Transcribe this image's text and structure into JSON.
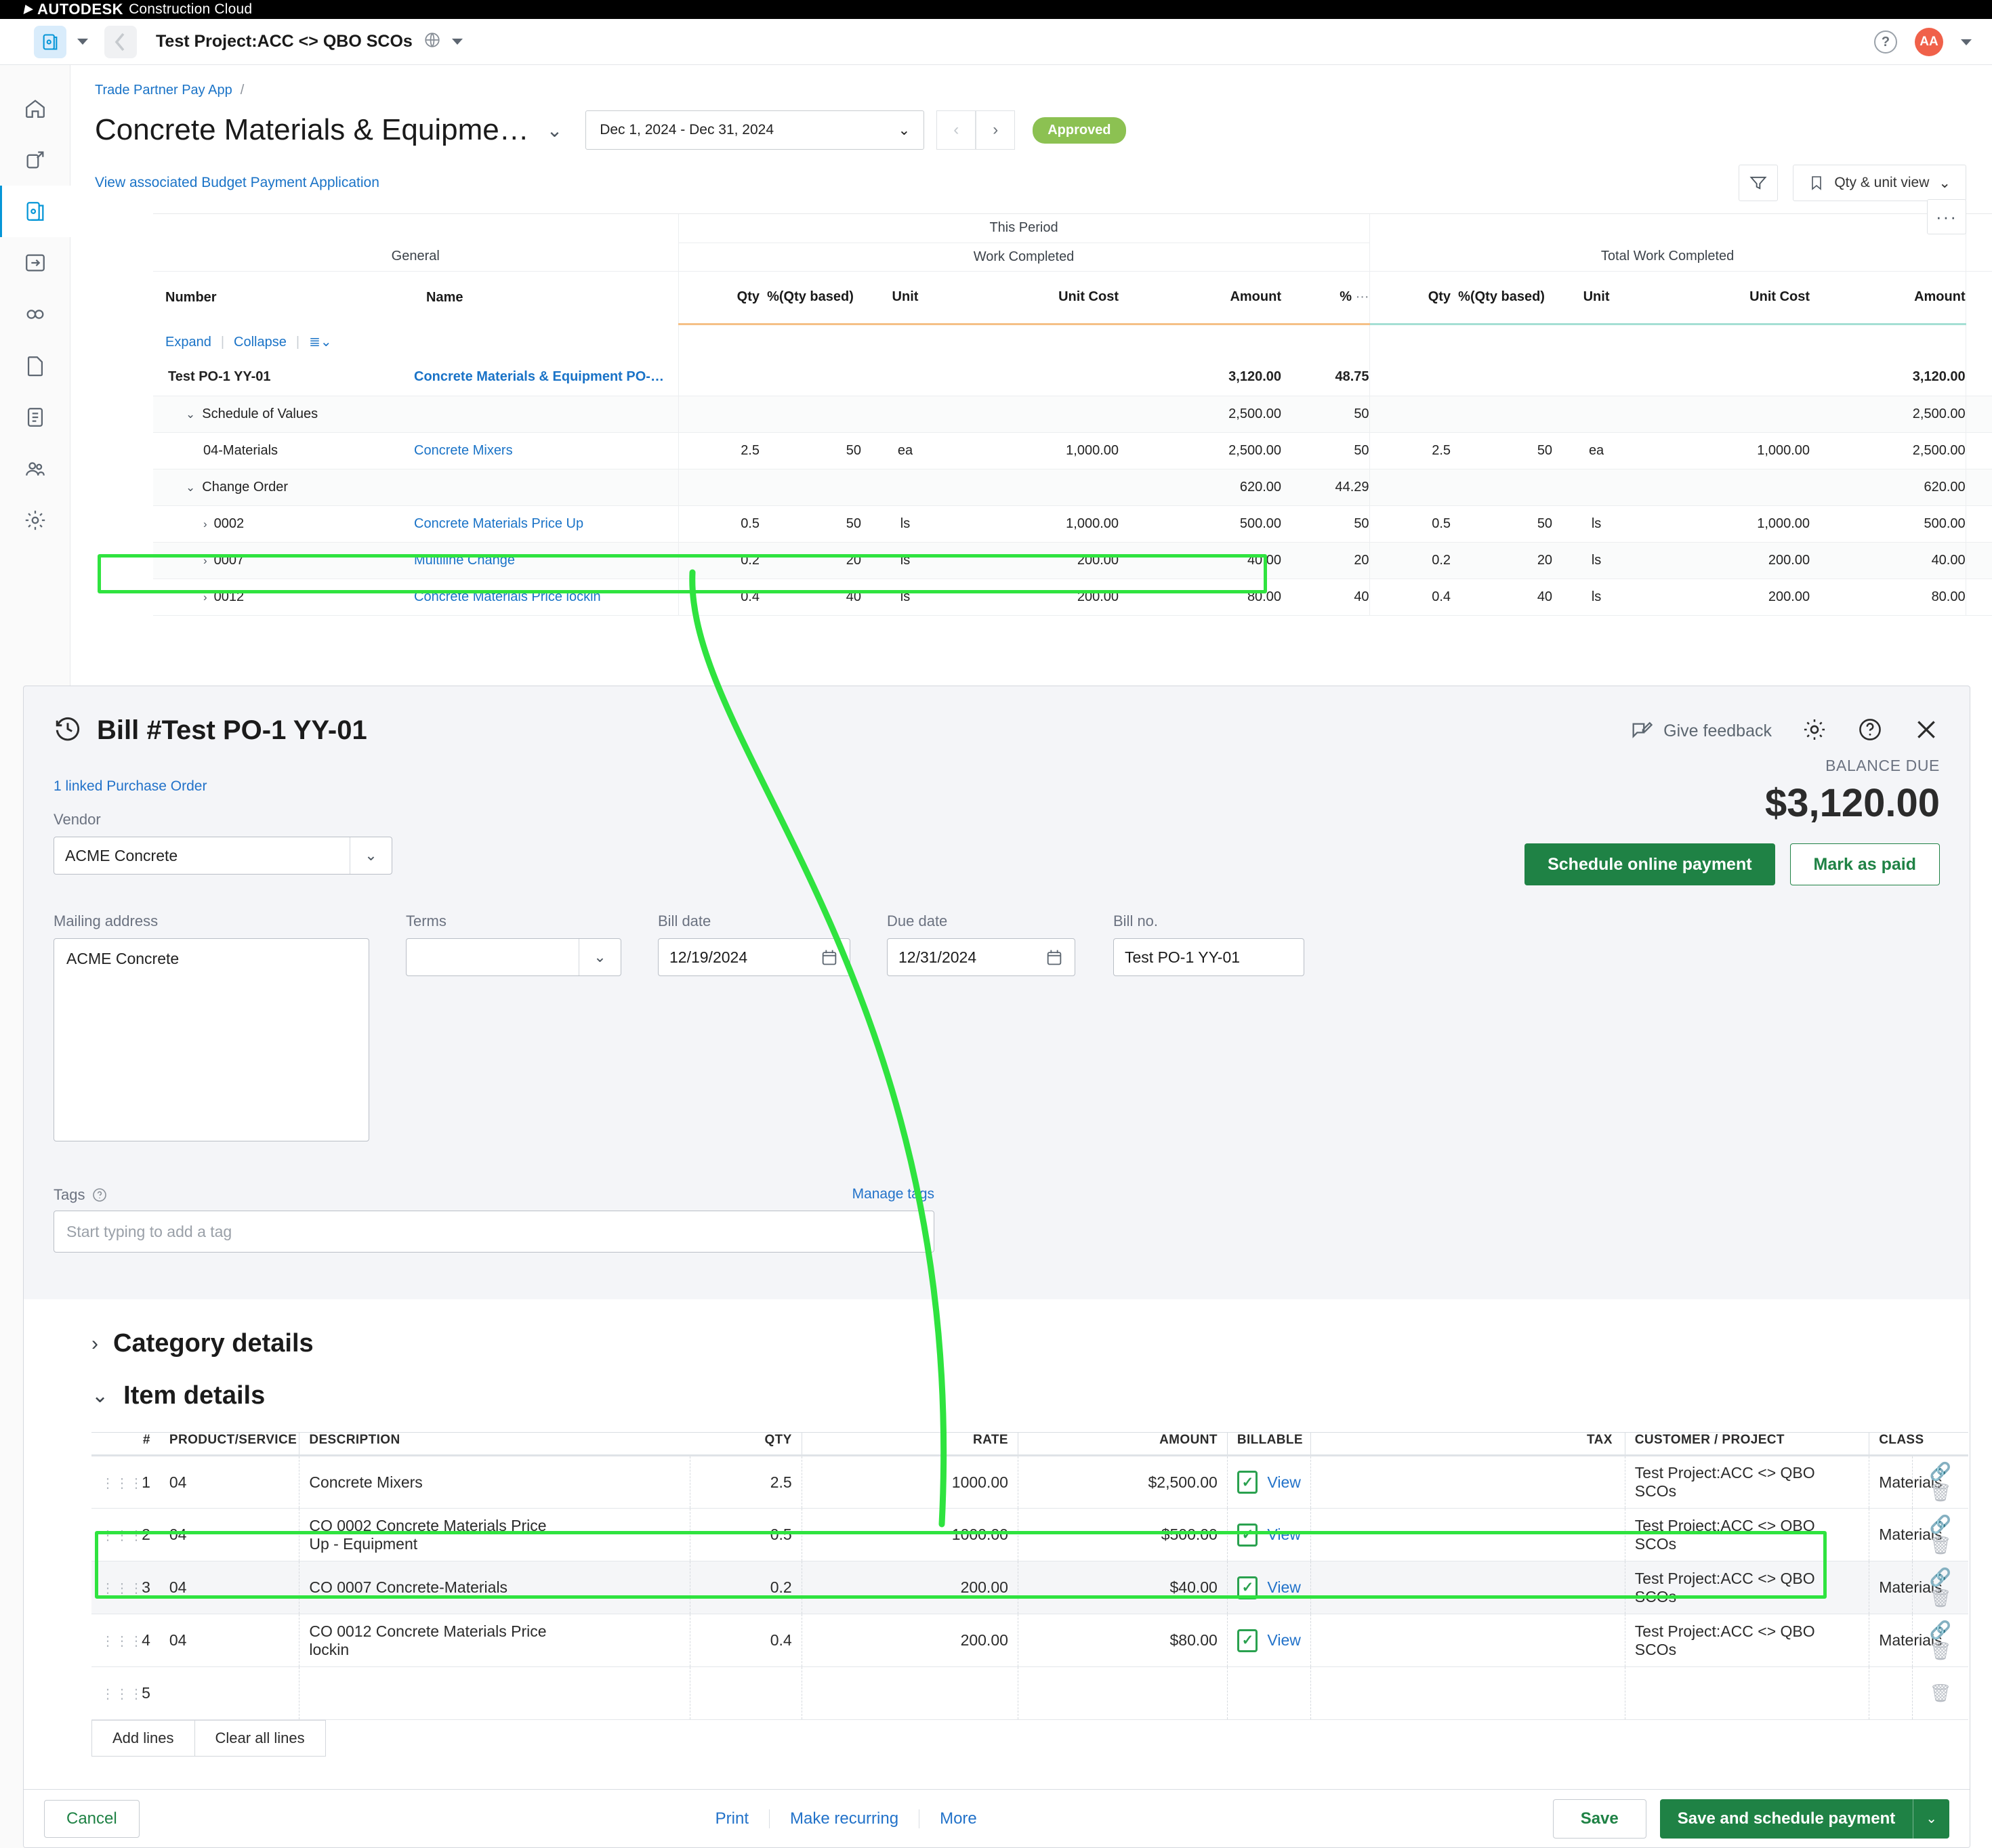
{
  "acc": {
    "brand_primary": "AUTODESK",
    "brand_secondary": "Construction Cloud",
    "project_name": "Test Project:ACC <> QBO SCOs",
    "avatar_initials": "AA",
    "breadcrumb": "Trade Partner Pay App",
    "breadcrumb_sep": "/",
    "page_title": "Concrete Materials & Equipme…",
    "date_range": "Dec 1, 2024 - Dec 31, 2024",
    "status_pill": "Approved",
    "assoc_link": "View associated Budget Payment Application",
    "qty_unit_view": "Qty & unit view",
    "expand": "Expand",
    "collapse": "Collapse",
    "accent_blue": "#1a73c7",
    "accent_green": "#8cc152"
  },
  "sov": {
    "group_general": "General",
    "group_this_period": "This Period",
    "group_work_completed": "Work Completed",
    "group_total_work_completed": "Total Work Completed",
    "cols_general": [
      "Number",
      "Name"
    ],
    "cols_period": [
      "Qty",
      "%(Qty based)",
      "Unit",
      "Unit Cost",
      "Amount",
      "%"
    ],
    "cols_total": [
      "Qty",
      "%(Qty based)",
      "Unit",
      "Unit Cost",
      "Amount"
    ],
    "rows": [
      {
        "number": "Test PO-1 YY-01",
        "name": "Concrete Materials & Equipment PO-…",
        "name_link": true,
        "bold": true,
        "p_qty": "",
        "p_pct": "",
        "p_unit": "",
        "p_cost": "",
        "p_amt": "3,120.00",
        "p_pctcol": "48.75",
        "t_qty": "",
        "t_pct": "",
        "t_unit": "",
        "t_cost": "",
        "t_amt": "3,120.00",
        "check": false,
        "indent": 0,
        "chevron": ""
      },
      {
        "number": "Schedule of Values",
        "name": "",
        "name_link": false,
        "bold": false,
        "p_qty": "",
        "p_pct": "",
        "p_unit": "",
        "p_cost": "",
        "p_amt": "2,500.00",
        "p_pctcol": "50",
        "t_qty": "",
        "t_pct": "",
        "t_unit": "",
        "t_cost": "",
        "t_amt": "2,500.00",
        "check": false,
        "indent": 1,
        "chevron": "down",
        "shade": true
      },
      {
        "number": "04-Materials",
        "name": "Concrete Mixers",
        "name_link": true,
        "bold": false,
        "p_qty": "2.5",
        "p_pct": "50",
        "p_unit": "ea",
        "p_cost": "1,000.00",
        "p_amt": "2,500.00",
        "p_pctcol": "50",
        "t_qty": "2.5",
        "t_pct": "50",
        "t_unit": "ea",
        "t_cost": "1,000.00",
        "t_amt": "2,500.00",
        "check": true,
        "indent": 2,
        "chevron": ""
      },
      {
        "number": "Change Order",
        "name": "",
        "name_link": false,
        "bold": false,
        "p_qty": "",
        "p_pct": "",
        "p_unit": "",
        "p_cost": "",
        "p_amt": "620.00",
        "p_pctcol": "44.29",
        "t_qty": "",
        "t_pct": "",
        "t_unit": "",
        "t_cost": "",
        "t_amt": "620.00",
        "check": false,
        "indent": 1,
        "chevron": "down",
        "shade": true
      },
      {
        "number": "0002",
        "name": "Concrete Materials Price Up",
        "name_link": true,
        "bold": false,
        "p_qty": "0.5",
        "p_pct": "50",
        "p_unit": "ls",
        "p_cost": "1,000.00",
        "p_amt": "500.00",
        "p_pctcol": "50",
        "t_qty": "0.5",
        "t_pct": "50",
        "t_unit": "ls",
        "t_cost": "1,000.00",
        "t_amt": "500.00",
        "check": true,
        "indent": 2,
        "chevron": "right"
      },
      {
        "number": "0007",
        "name": "Multiline Change",
        "name_link": true,
        "bold": false,
        "p_qty": "0.2",
        "p_pct": "20",
        "p_unit": "ls",
        "p_cost": "200.00",
        "p_amt": "40.00",
        "p_pctcol": "20",
        "t_qty": "0.2",
        "t_pct": "20",
        "t_unit": "ls",
        "t_cost": "200.00",
        "t_amt": "40.00",
        "check": true,
        "indent": 2,
        "chevron": "right",
        "shade": true
      },
      {
        "number": "0012",
        "name": "Concrete Materials Price lockin",
        "name_link": true,
        "bold": false,
        "p_qty": "0.4",
        "p_pct": "40",
        "p_unit": "ls",
        "p_cost": "200.00",
        "p_amt": "80.00",
        "p_pctcol": "40",
        "t_qty": "0.4",
        "t_pct": "40",
        "t_unit": "ls",
        "t_cost": "200.00",
        "t_amt": "80.00",
        "check": true,
        "indent": 2,
        "chevron": "right"
      }
    ]
  },
  "bill": {
    "title": "Bill #Test PO-1 YY-01",
    "give_feedback": "Give feedback",
    "linked_po": "1 linked Purchase Order",
    "vendor_label": "Vendor",
    "vendor_value": "ACME Concrete",
    "mailing_label": "Mailing address",
    "mailing_value": "ACME Concrete",
    "terms_label": "Terms",
    "terms_value": "",
    "bill_date_label": "Bill date",
    "bill_date_value": "12/19/2024",
    "due_date_label": "Due date",
    "due_date_value": "12/31/2024",
    "bill_no_label": "Bill no.",
    "bill_no_value": "Test PO-1 YY-01",
    "tags_label": "Tags",
    "tags_placeholder": "Start typing to add a tag",
    "manage_tags": "Manage tags",
    "balance_label": "BALANCE DUE",
    "balance_amount": "$3,120.00",
    "schedule_btn": "Schedule online payment",
    "mark_paid_btn": "Mark as paid",
    "category_details": "Category details",
    "item_details": "Item details",
    "green_accent": "#1f8245"
  },
  "items": {
    "columns": [
      "#",
      "PRODUCT/SERVICE",
      "DESCRIPTION",
      "QTY",
      "RATE",
      "AMOUNT",
      "BILLABLE",
      "TAX",
      "CUSTOMER / PROJECT",
      "CLASS"
    ],
    "billable_link": "View",
    "rows": [
      {
        "n": "1",
        "product": "04",
        "description": "Concrete Mixers",
        "qty": "2.5",
        "rate": "1000.00",
        "amount": "$2,500.00",
        "billable": true,
        "tax": "",
        "customer": "Test Project:ACC <> QBO SCOs",
        "class": "Materials"
      },
      {
        "n": "2",
        "product": "04",
        "description": "CO 0002 Concrete Materials Price Up - Equipment",
        "qty": "0.5",
        "rate": "1000.00",
        "amount": "$500.00",
        "billable": true,
        "tax": "",
        "customer": "Test Project:ACC <> QBO SCOs",
        "class": "Materials"
      },
      {
        "n": "3",
        "product": "04",
        "description": "CO 0007 Concrete-Materials",
        "qty": "0.2",
        "rate": "200.00",
        "amount": "$40.00",
        "billable": true,
        "tax": "",
        "customer": "Test Project:ACC <> QBO SCOs",
        "class": "Materials"
      },
      {
        "n": "4",
        "product": "04",
        "description": "CO 0012 Concrete Materials Price lockin",
        "qty": "0.4",
        "rate": "200.00",
        "amount": "$80.00",
        "billable": true,
        "tax": "",
        "customer": "Test Project:ACC <> QBO SCOs",
        "class": "Materials"
      },
      {
        "n": "5",
        "product": "",
        "description": "",
        "qty": "",
        "rate": "",
        "amount": "",
        "billable": false,
        "tax": "",
        "customer": "",
        "class": ""
      }
    ],
    "add_lines": "Add lines",
    "clear_all_lines": "Clear all lines"
  },
  "footer": {
    "cancel": "Cancel",
    "print": "Print",
    "make_recurring": "Make recurring",
    "more": "More",
    "save": "Save",
    "save_schedule": "Save and schedule payment"
  }
}
